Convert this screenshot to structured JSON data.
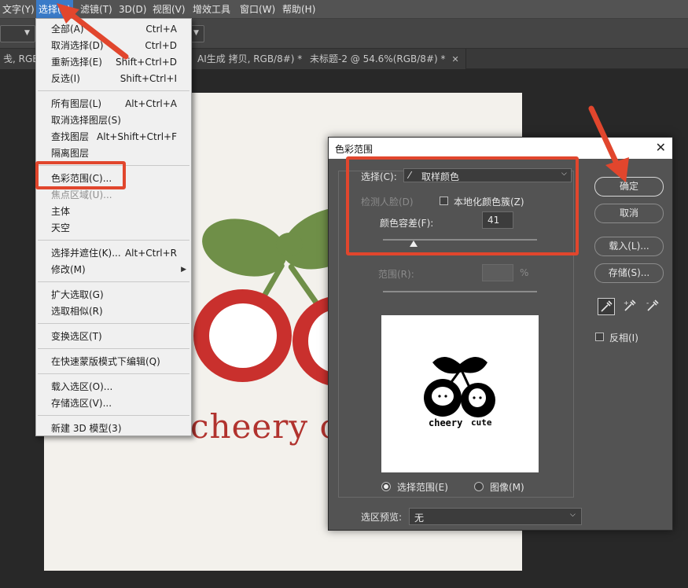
{
  "menubar": {
    "items": [
      "文字(Y)",
      "选择(S)",
      "滤镜(T)",
      "3D(D)",
      "视图(V)",
      "增效工具",
      "窗口(W)",
      "帮助(H)"
    ]
  },
  "tabs": {
    "tab1": "戋, RGB/8#",
    "tab2": "AI生成 拷贝, RGB/8#) *",
    "tab3": "未标题-2 @ 54.6%(RGB/8#) *"
  },
  "canvas": {
    "text1": "cheery",
    "text2": "c"
  },
  "select_menu": {
    "groups": [
      [
        {
          "label": "全部(A)",
          "shortcut": "Ctrl+A"
        },
        {
          "label": "取消选择(D)",
          "shortcut": "Ctrl+D"
        },
        {
          "label": "重新选择(E)",
          "shortcut": "Shift+Ctrl+D"
        },
        {
          "label": "反选(I)",
          "shortcut": "Shift+Ctrl+I"
        }
      ],
      [
        {
          "label": "所有图层(L)",
          "shortcut": "Alt+Ctrl+A"
        },
        {
          "label": "取消选择图层(S)",
          "shortcut": ""
        },
        {
          "label": "查找图层",
          "shortcut": "Alt+Shift+Ctrl+F"
        },
        {
          "label": "隔离图层",
          "shortcut": ""
        }
      ],
      [
        {
          "label": "色彩范围(C)...",
          "shortcut": ""
        },
        {
          "label": "焦点区域(U)...",
          "shortcut": ""
        },
        {
          "label": "主体",
          "shortcut": ""
        },
        {
          "label": "天空",
          "shortcut": ""
        }
      ],
      [
        {
          "label": "选择并遮住(K)...",
          "shortcut": "Alt+Ctrl+R"
        },
        {
          "label": "修改(M)",
          "shortcut": ""
        }
      ],
      [
        {
          "label": "扩大选取(G)",
          "shortcut": ""
        },
        {
          "label": "选取相似(R)",
          "shortcut": ""
        }
      ],
      [
        {
          "label": "变换选区(T)",
          "shortcut": ""
        }
      ],
      [
        {
          "label": "在快速蒙版模式下编辑(Q)",
          "shortcut": ""
        }
      ],
      [
        {
          "label": "载入选区(O)...",
          "shortcut": ""
        },
        {
          "label": "存储选区(V)...",
          "shortcut": ""
        }
      ],
      [
        {
          "label": "新建 3D 模型(3)",
          "shortcut": ""
        }
      ]
    ]
  },
  "dialog": {
    "title": "色彩范围",
    "select_label": "选择(C):",
    "select_value": "取样颜色",
    "detect_faces": "检测人脸(D)",
    "localized_clusters": "本地化颜色簇(Z)",
    "fuzziness_label": "颜色容差(F):",
    "fuzziness_value": "41",
    "fuzziness_level": 0.2,
    "range_label": "范围(R):",
    "range_unit": "%",
    "preview_text1": "cheery",
    "preview_text2": "cute",
    "radio_selection": "选择范围(E)",
    "radio_image": "图像(M)",
    "selection_preview_label": "选区预览:",
    "selection_preview_value": "无",
    "ok": "确定",
    "cancel": "取消",
    "load": "载入(L)...",
    "save": "存储(S)...",
    "invert": "反相(I)"
  },
  "colors": {
    "accent_red": "#e1462d",
    "menu_highlight": "#3a7bc8",
    "cherry_red": "#c9302d",
    "leaf_green": "#6f8f48"
  }
}
